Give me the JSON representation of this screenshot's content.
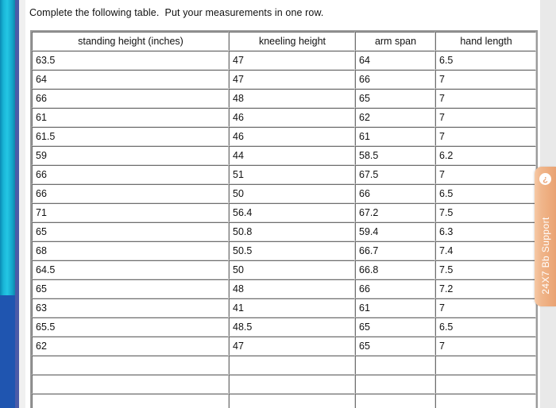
{
  "instruction": "Complete the following table.  Put your measurements in one row.",
  "table": {
    "headers": [
      "standing height (inches)",
      "kneeling height",
      "arm span",
      "hand length"
    ],
    "rows": [
      [
        "63.5",
        "47",
        "64",
        "6.5"
      ],
      [
        "64",
        "47",
        "66",
        "7"
      ],
      [
        "66",
        "48",
        "65",
        "7"
      ],
      [
        "61",
        "46",
        "62",
        "7"
      ],
      [
        "61.5",
        "46",
        "61",
        "7"
      ],
      [
        "59",
        "44",
        "58.5",
        "6.2"
      ],
      [
        "66",
        "51",
        "67.5",
        "7"
      ],
      [
        "66",
        "50",
        "66",
        "6.5"
      ],
      [
        "71",
        "56.4",
        "67.2",
        "7.5"
      ],
      [
        "65",
        "50.8",
        "59.4",
        "6.3"
      ],
      [
        "68",
        "50.5",
        "66.7",
        "7.4"
      ],
      [
        "64.5",
        "50",
        "66.8",
        "7.5"
      ],
      [
        "65",
        "48",
        "66",
        "7.2"
      ],
      [
        "63",
        "41",
        "61",
        "7"
      ],
      [
        "65.5",
        "48.5",
        "65",
        "6.5"
      ],
      [
        "62",
        "47",
        "65",
        "7"
      ],
      [
        "",
        "",
        "",
        ""
      ],
      [
        "",
        "",
        "",
        ""
      ],
      [
        "",
        "",
        "",
        ""
      ]
    ]
  },
  "support_tab": {
    "label": "24X7 Bb Support",
    "icon": "question-mark-icon",
    "icon_glyph": "?"
  },
  "colors": {
    "rail_top": "#18b4d6",
    "rail_bottom": "#1f55b0",
    "rail_divider": "#4a5ba8",
    "support_tab": "#eeae80",
    "page_background": "#ffffff",
    "grey_margin": "#e9e9e9",
    "table_border": "#9a9a9a",
    "text": "#111111"
  }
}
